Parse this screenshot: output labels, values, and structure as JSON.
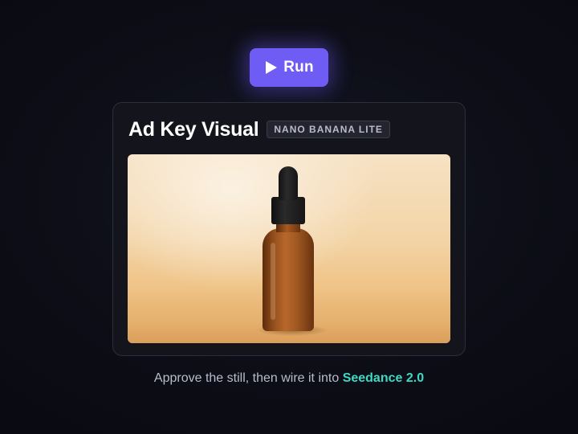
{
  "run_button": {
    "label": "Run",
    "icon": "play-icon",
    "color": "#6f5cf5"
  },
  "card": {
    "title": "Ad Key Visual",
    "badge": "NANO BANANA LITE",
    "image": {
      "subject": "amber-dropper-bottle",
      "background_color": "#f3d4a6"
    }
  },
  "caption": {
    "prefix": "Approve the still, then wire it into ",
    "highlight": "Seedance 2.0",
    "highlight_color": "#3fd9c3"
  }
}
